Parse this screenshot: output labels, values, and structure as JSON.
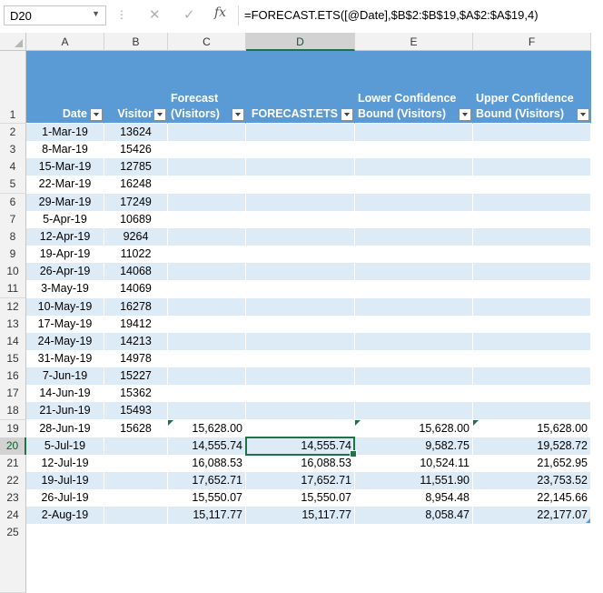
{
  "name_box": "D20",
  "formula": "=FORECAST.ETS([@Date],$B$2:$B$19,$A$2:$A$19,4)",
  "columns": [
    "A",
    "B",
    "C",
    "D",
    "E",
    "F"
  ],
  "selected_column": "D",
  "selected_row": "20",
  "header_row": "1",
  "headers": [
    {
      "text": "Date",
      "filter": true
    },
    {
      "text": "Visitor",
      "filter": true
    },
    {
      "text": "Forecast\n(Visitors)",
      "filter": true
    },
    {
      "text": "FORECAST.ETS",
      "filter": true
    },
    {
      "text": "Lower Confidence\nBound (Visitors)",
      "filter": true
    },
    {
      "text": "Upper Confidence\nBound (Visitors)",
      "filter": true
    }
  ],
  "rows": [
    {
      "row": "2",
      "cells": [
        "1-Mar-19",
        "13624",
        "",
        "",
        "",
        ""
      ]
    },
    {
      "row": "3",
      "cells": [
        "8-Mar-19",
        "15426",
        "",
        "",
        "",
        ""
      ]
    },
    {
      "row": "4",
      "cells": [
        "15-Mar-19",
        "12785",
        "",
        "",
        "",
        ""
      ]
    },
    {
      "row": "5",
      "cells": [
        "22-Mar-19",
        "16248",
        "",
        "",
        "",
        ""
      ]
    },
    {
      "row": "6",
      "cells": [
        "29-Mar-19",
        "17249",
        "",
        "",
        "",
        ""
      ]
    },
    {
      "row": "7",
      "cells": [
        "5-Apr-19",
        "10689",
        "",
        "",
        "",
        ""
      ]
    },
    {
      "row": "8",
      "cells": [
        "12-Apr-19",
        "9264",
        "",
        "",
        "",
        ""
      ]
    },
    {
      "row": "9",
      "cells": [
        "19-Apr-19",
        "11022",
        "",
        "",
        "",
        ""
      ]
    },
    {
      "row": "10",
      "cells": [
        "26-Apr-19",
        "14068",
        "",
        "",
        "",
        ""
      ]
    },
    {
      "row": "11",
      "cells": [
        "3-May-19",
        "14069",
        "",
        "",
        "",
        ""
      ]
    },
    {
      "row": "12",
      "cells": [
        "10-May-19",
        "16278",
        "",
        "",
        "",
        ""
      ]
    },
    {
      "row": "13",
      "cells": [
        "17-May-19",
        "19412",
        "",
        "",
        "",
        ""
      ]
    },
    {
      "row": "14",
      "cells": [
        "24-May-19",
        "14213",
        "",
        "",
        "",
        ""
      ]
    },
    {
      "row": "15",
      "cells": [
        "31-May-19",
        "14978",
        "",
        "",
        "",
        ""
      ]
    },
    {
      "row": "16",
      "cells": [
        "7-Jun-19",
        "15227",
        "",
        "",
        "",
        ""
      ]
    },
    {
      "row": "17",
      "cells": [
        "14-Jun-19",
        "15362",
        "",
        "",
        "",
        ""
      ]
    },
    {
      "row": "18",
      "cells": [
        "21-Jun-19",
        "15493",
        "",
        "",
        "",
        ""
      ]
    },
    {
      "row": "19",
      "cells": [
        "28-Jun-19",
        "15628",
        "15,628.00",
        "",
        "15,628.00",
        "15,628.00"
      ]
    },
    {
      "row": "20",
      "cells": [
        "5-Jul-19",
        "",
        "14,555.74",
        "14,555.74",
        "9,582.75",
        "19,528.72"
      ]
    },
    {
      "row": "21",
      "cells": [
        "12-Jul-19",
        "",
        "16,088.53",
        "16,088.53",
        "10,524.11",
        "21,652.95"
      ]
    },
    {
      "row": "22",
      "cells": [
        "19-Jul-19",
        "",
        "17,652.71",
        "17,652.71",
        "11,551.90",
        "23,753.52"
      ]
    },
    {
      "row": "23",
      "cells": [
        "26-Jul-19",
        "",
        "15,550.07",
        "15,550.07",
        "8,954.48",
        "22,145.66"
      ]
    },
    {
      "row": "24",
      "cells": [
        "2-Aug-19",
        "",
        "15,117.77",
        "15,117.77",
        "8,058.47",
        "22,177.07"
      ]
    }
  ],
  "next_row": "25",
  "colors": {
    "table_header": "#5b9bd5",
    "band": "#ddebf7",
    "selection": "#217346"
  }
}
